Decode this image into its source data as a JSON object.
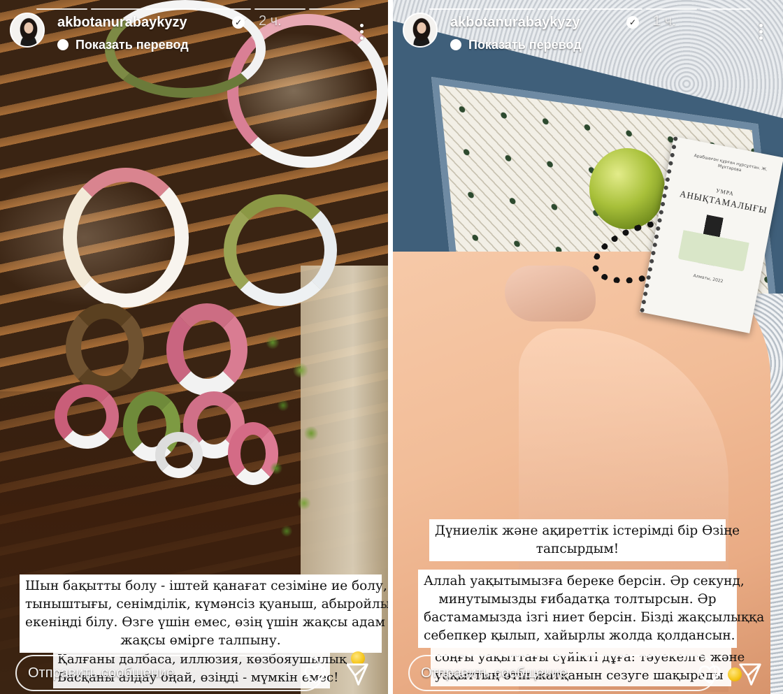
{
  "stories": [
    {
      "username": "akbotanurabaykyzy",
      "time": "2 ч.",
      "translate_label": "Показать перевод",
      "caption_main": [
        "Шын бақытты болу - іштей қанағат сезіміне ие болу, жан",
        "тыныштығы, сенімділік, күмәнсіз қуаныш, абыройлы әрі адал",
        "екеніңді білу. Өзге үшін емес, өзің үшін жақсы адам боп,",
        "жақсы өмірге талпыну."
      ],
      "caption_bottom": [
        "Қалғаны далбаса, иллюзия, көзбояушылық",
        "Басқаны алдау оңай, өзіңді - мүмкін емес!"
      ],
      "reply_placeholder": "Отправить сообщение"
    },
    {
      "username": "akbotanurabaykyzy",
      "time": "1 ч.",
      "translate_label": "Показать перевод",
      "caption_top": [
        "Дүниелік және ақиреттік істерімді бір Өзіңе",
        "тапсырдым!"
      ],
      "caption_main": [
        "Аллаһ уақытымызға береке берсін. Әр секунд,",
        "минутымызды ғибадатқа толтырсын. Әр",
        "бастамамызда ізгі ниет берсін. Бізді жақсылыққа",
        "себепкер қылып, хайырлы жолда қолдансын."
      ],
      "caption_bottom": [
        "соңғы уақыттағы сүйікті дұға: тәуекелге және",
        "уақыттың өтіп жатқанын сезуге шақырады"
      ],
      "reply_placeholder": "Отправить сообщение",
      "notebook": {
        "top_text": "Арабшаған құрған нұрсұлтан. Ж. Мұхтарова",
        "title_small": "УМРА",
        "title": "АНЫҚТАМАЛЫҒЫ",
        "bottom_text": "Алматы, 2022"
      }
    }
  ],
  "icons": {
    "verified": "verified-badge-icon",
    "more": "more-options-icon",
    "translate": "translate-dot-icon",
    "heart": "heart-icon",
    "send": "send-icon",
    "emoji": "emoji-icon"
  },
  "colors": {
    "caption_bg": "#ffffff",
    "caption_text": "#111111",
    "chrome_text": "#ffffff"
  }
}
